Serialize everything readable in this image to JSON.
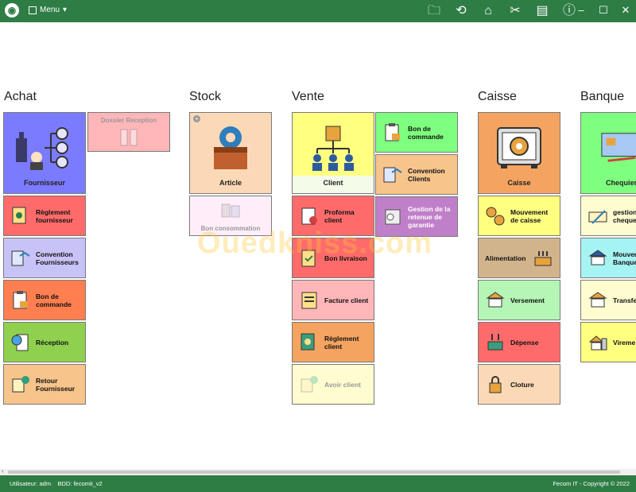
{
  "topbar": {
    "menu_label": "Menu",
    "icons": [
      "folder-icon",
      "history-icon",
      "bank-icon",
      "tools-icon",
      "id-card-icon",
      "info-icon"
    ]
  },
  "sections": {
    "achat": "Achat",
    "stock": "Stock",
    "vente": "Vente",
    "caisse": "Caisse",
    "banque": "Banque"
  },
  "tiles": {
    "fournisseur": "Fournisseur",
    "dossier_reception": "Dossier Reception",
    "reglement_fournisseur": "Règlement fournisseur",
    "convention_fournisseurs": "Convention Fournisseurs",
    "bon_de_commande_achat": "Bon de commande",
    "reception": "Réception",
    "retour_fournisseur": "Retour Fournisseur",
    "article": "Article",
    "bon_consommation": "Bon consommation",
    "client": "Client",
    "bon_de_commande_vente": "Bon de commande",
    "convention_clients": "Convention Clients",
    "gestion_retenue": "Gestion de la retenue de garantie",
    "proforma_client": "Proforma client",
    "bon_livraison": "Bon livraison",
    "facture_client": "Facture client",
    "reglement_client": "Règlement client",
    "avoir_client": "Avoir client",
    "caisse": "Caisse",
    "mouvement_caisse": "Mouvement de caisse",
    "alimentation": "Alimentation",
    "versement": "Versement",
    "depense": "Dépense",
    "cloture": "Cloture",
    "chequier": "Chequier",
    "gestion_cheque": "gestion cheque",
    "mouvement_banque": "Mouvem Banque",
    "transfert": "Transfe",
    "virement": "Vireme"
  },
  "colors": {
    "topbar": "#2e7d45",
    "blue": "#7b7bff",
    "pink": "#ffb6b9",
    "red": "#ff6b6b",
    "lavender": "#c8c3f7",
    "orange": "#ff7f50",
    "green": "#8fd14f",
    "peach": "#f7c48c",
    "light_peach": "#fcd9b6",
    "yellow": "#ffff80",
    "light_yellow": "#fffdd0",
    "mint": "#7fff7f",
    "purple": "#c07fc9",
    "tan": "#d2b48c",
    "light_green": "#b5f5b5",
    "cyan": "#a6f3f3"
  },
  "watermark": "Ouedkniss.com",
  "footer": {
    "user": "Utilisateur: adm",
    "bdd": "BDD: fecomit_v2",
    "copyright": "Fecom IT - Copyright © 2022"
  }
}
